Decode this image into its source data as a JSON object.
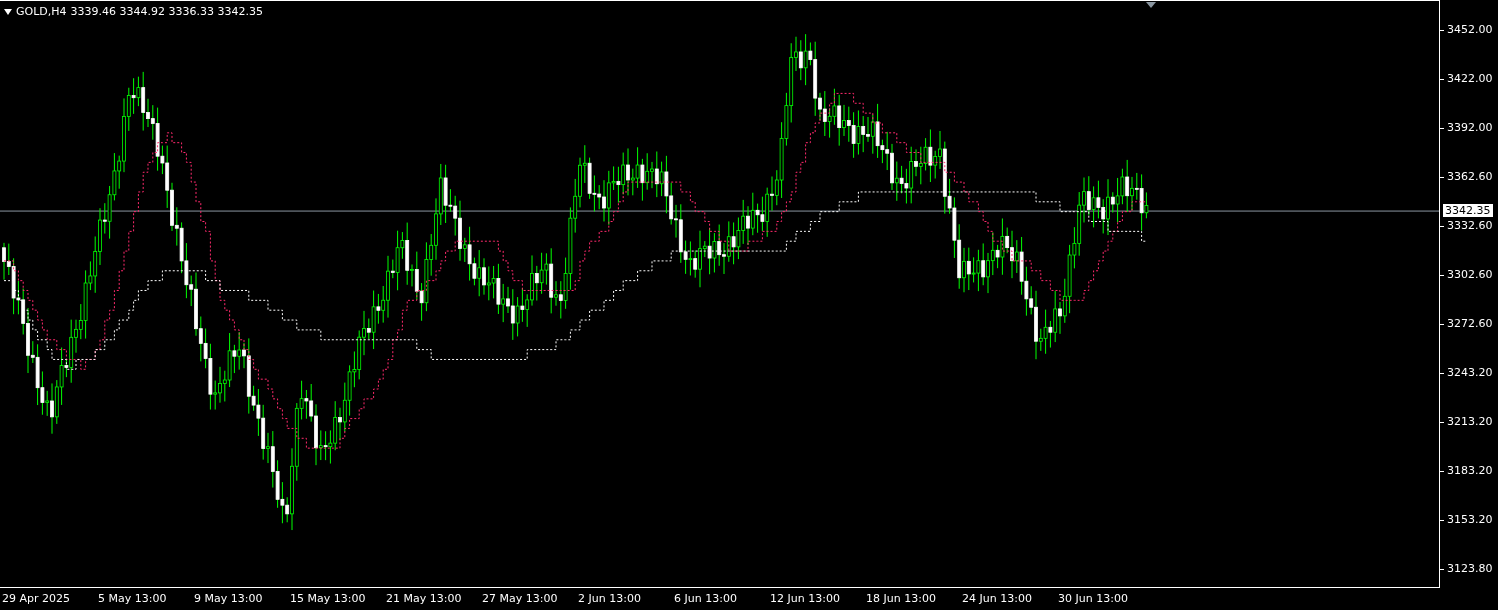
{
  "header": {
    "symbol_timeframe": "GOLD,H4",
    "ohlc": "3339.46 3344.92 3336.33 3342.35"
  },
  "price_axis": [
    "3452.00",
    "3422.00",
    "3392.00",
    "3362.60",
    "3332.60",
    "3302.60",
    "3272.60",
    "3243.20",
    "3213.20",
    "3183.20",
    "3153.20",
    "3123.80"
  ],
  "current_price": "3342.35",
  "time_axis": [
    "29 Apr 2025",
    "5 May 13:00",
    "9 May 13:00",
    "15 May 13:00",
    "21 May 13:00",
    "27 May 13:00",
    "2 Jun 13:00",
    "6 Jun 13:00",
    "12 Jun 13:00",
    "18 Jun 13:00",
    "24 Jun 13:00",
    "30 Jun 13:00"
  ]
}
